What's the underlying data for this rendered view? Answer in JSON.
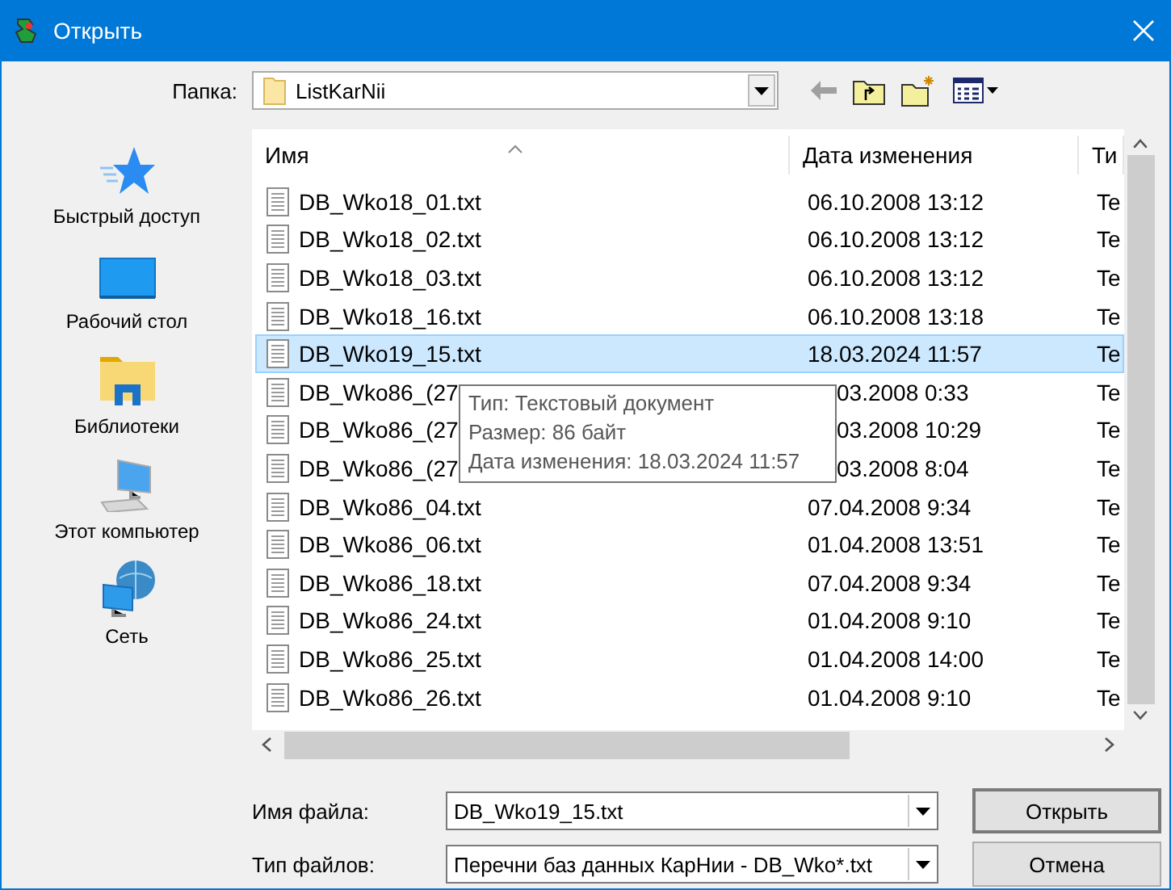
{
  "window": {
    "title": "Открыть"
  },
  "toolbar": {
    "label": "Папка:",
    "folder": "ListKarNii",
    "back_disabled": true
  },
  "places": [
    {
      "label": "Быстрый доступ",
      "kind": "star"
    },
    {
      "label": "Рабочий стол",
      "kind": "desktop"
    },
    {
      "label": "Библиотеки",
      "kind": "libraries"
    },
    {
      "label": "Этот компьютер",
      "kind": "computer"
    },
    {
      "label": "Сеть",
      "kind": "network"
    }
  ],
  "file_list": {
    "columns": [
      "Имя",
      "Дата изменения",
      "Ти"
    ],
    "rows": [
      {
        "name": "DB_Wko18_01.txt",
        "date": "06.10.2008 13:12",
        "type": "Te",
        "selected": false,
        "under_tooltip": false
      },
      {
        "name": "DB_Wko18_02.txt",
        "date": "06.10.2008 13:12",
        "type": "Te",
        "selected": false,
        "under_tooltip": false
      },
      {
        "name": "DB_Wko18_03.txt",
        "date": "06.10.2008 13:12",
        "type": "Te",
        "selected": false,
        "under_tooltip": false
      },
      {
        "name": "DB_Wko18_16.txt",
        "date": "06.10.2008 13:18",
        "type": "Te",
        "selected": false,
        "under_tooltip": false
      },
      {
        "name": "DB_Wko19_15.txt",
        "date": "18.03.2024 11:57",
        "type": "Te",
        "selected": true,
        "under_tooltip": false
      },
      {
        "name": "DB_Wko86_(27",
        "date": "03.2008 0:33",
        "type": "Te",
        "selected": false,
        "under_tooltip": true
      },
      {
        "name": "DB_Wko86_(27",
        "date": "03.2008 10:29",
        "type": "Te",
        "selected": false,
        "under_tooltip": true
      },
      {
        "name": "DB_Wko86_(27",
        "date": "03.2008 8:04",
        "type": "Te",
        "selected": false,
        "under_tooltip": true
      },
      {
        "name": "DB_Wko86_04.txt",
        "date": "07.04.2008 9:34",
        "type": "Te",
        "selected": false,
        "under_tooltip": false
      },
      {
        "name": "DB_Wko86_06.txt",
        "date": "01.04.2008 13:51",
        "type": "Te",
        "selected": false,
        "under_tooltip": false
      },
      {
        "name": "DB_Wko86_18.txt",
        "date": "07.04.2008 9:34",
        "type": "Te",
        "selected": false,
        "under_tooltip": false
      },
      {
        "name": "DB_Wko86_24.txt",
        "date": "01.04.2008 9:10",
        "type": "Te",
        "selected": false,
        "under_tooltip": false
      },
      {
        "name": "DB_Wko86_25.txt",
        "date": "01.04.2008 14:00",
        "type": "Te",
        "selected": false,
        "under_tooltip": false
      },
      {
        "name": "DB_Wko86_26.txt",
        "date": "01.04.2008 9:10",
        "type": "Te",
        "selected": false,
        "under_tooltip": false
      }
    ],
    "tooltip": {
      "lines": [
        "Тип: Текстовый документ",
        "Размер: 86 байт",
        "Дата изменения: 18.03.2024 11:57"
      ]
    }
  },
  "file_name": {
    "label": "Имя файла:",
    "value": "DB_Wko19_15.txt"
  },
  "file_type": {
    "label": "Тип файлов:",
    "value": "Перечни баз данных КарНии - DB_Wko*.txt"
  },
  "buttons": [
    {
      "label": "Открыть",
      "default": true
    },
    {
      "label": "Отмена",
      "default": false
    }
  ]
}
